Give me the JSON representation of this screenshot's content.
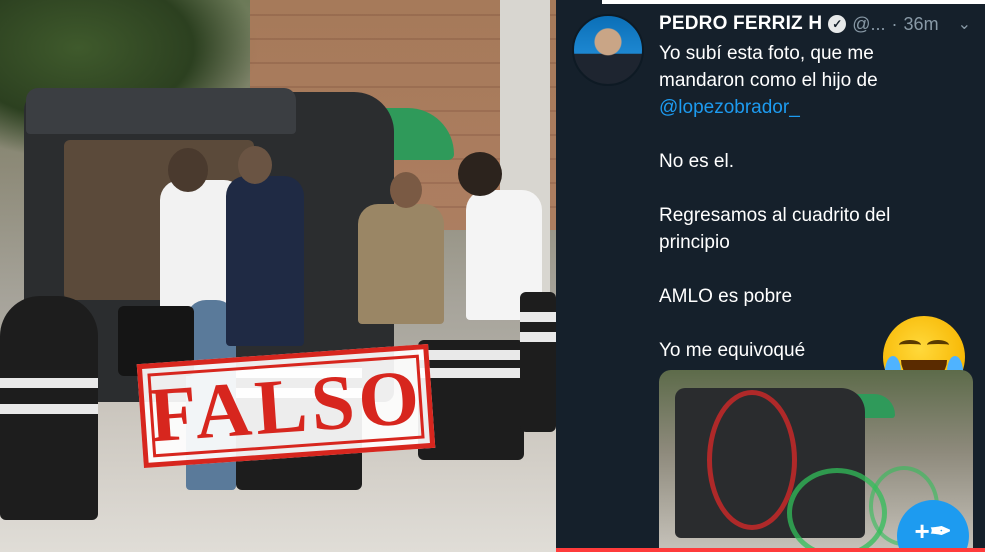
{
  "photo": {
    "stamp_text": "FALSO"
  },
  "tweet": {
    "author_name": "PEDRO FERRIZ H",
    "handle": "@...",
    "separator": "·",
    "time": "36m",
    "body": {
      "line1": "Yo subí esta foto, que me mandaron como el hijo de",
      "mention": "@lopezobrador_",
      "p2": "No es el.",
      "p3": "Regresamos al cuadrito del principio",
      "p4": "AMLO es pobre",
      "p5": "Yo me equivoqué"
    },
    "icons": {
      "verified": "verified-badge-icon",
      "menu": "chevron-down-icon",
      "emoji": "laughing-tears-emoji",
      "compose": "compose-tweet-icon"
    },
    "compose_glyph": "+✒"
  },
  "colors": {
    "stamp_red": "#d7261e",
    "tweet_bg": "#15202b",
    "link_blue": "#1d9bf0"
  }
}
